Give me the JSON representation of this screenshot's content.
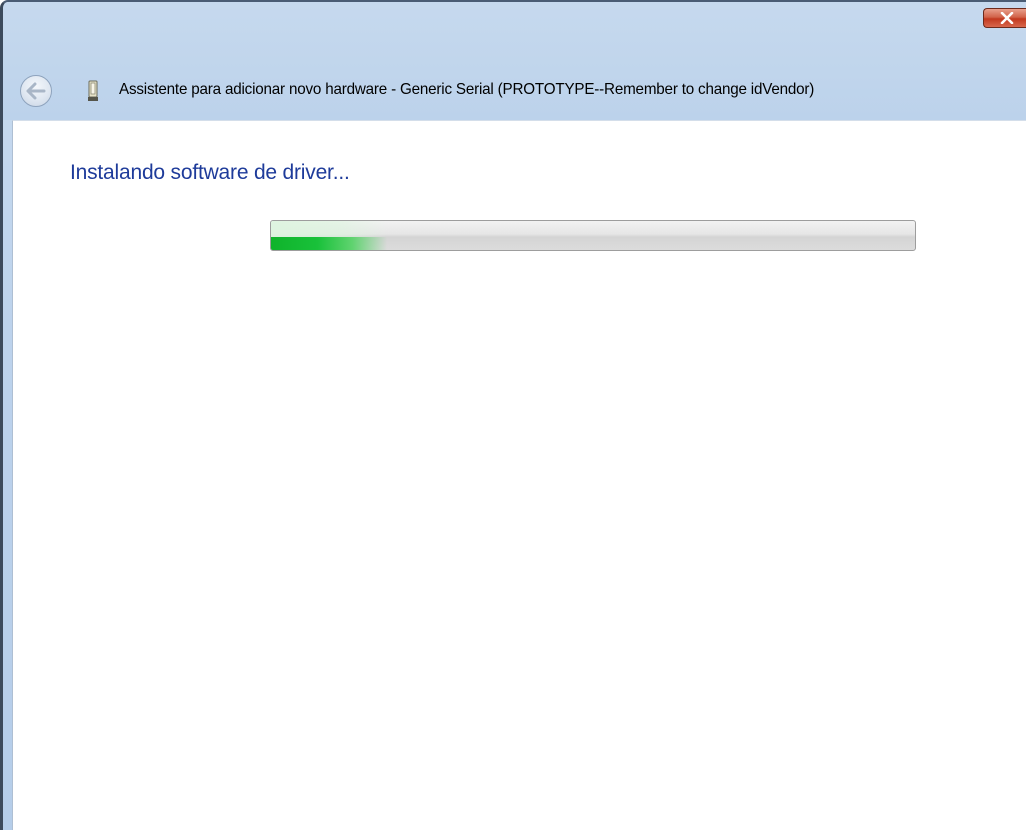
{
  "window": {
    "title": "Assistente para adicionar novo hardware - Generic Serial (PROTOTYPE--Remember to change idVendor)"
  },
  "icons": {
    "close": "close-icon",
    "back": "back-arrow-icon",
    "hardware": "usb-device-icon"
  },
  "content": {
    "heading": "Instalando software de driver...",
    "progress": 0.18
  },
  "colors": {
    "heading": "#1e3b9a",
    "progress_fill": "#19c13a",
    "close_button": "#c2391f"
  }
}
